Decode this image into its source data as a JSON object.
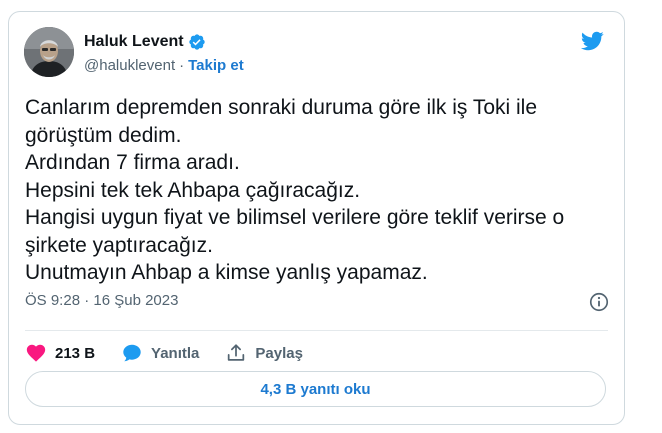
{
  "author": {
    "name": "Haluk Levent",
    "handle": "@haluklevent",
    "separator": "·",
    "follow_label": "Takip et"
  },
  "tweet": {
    "lines": [
      "Canlarım depremden sonraki duruma göre ilk iş Toki ile",
      "görüştüm dedim.",
      "Ardından 7 firma aradı.",
      "Hepsini tek tek Ahbapa çağıracağız.",
      "Hangisi uygun fiyat ve bilimsel verilere göre teklif verirse o",
      "şirkete yaptıracağız.",
      "Unutmayın Ahbap a kimse yanlış yapamaz."
    ],
    "timestamp": "ÖS 9:28 · 16 Şub 2023"
  },
  "actions": {
    "like_count": "213 B",
    "reply_label": "Yanıtla",
    "share_label": "Paylaş"
  },
  "replies_button": "4,3 B yanıtı oku",
  "colors": {
    "link_blue": "#1d7ad0",
    "twitter_blue": "#1d9bf0",
    "heart_pink": "#f91880",
    "verified_blue": "#1d9bf0",
    "muted_gray": "#536471"
  },
  "icons": [
    "avatar",
    "verified-badge-icon",
    "twitter-bird-icon",
    "info-icon",
    "heart-icon",
    "reply-bubble-icon",
    "share-icon"
  ]
}
